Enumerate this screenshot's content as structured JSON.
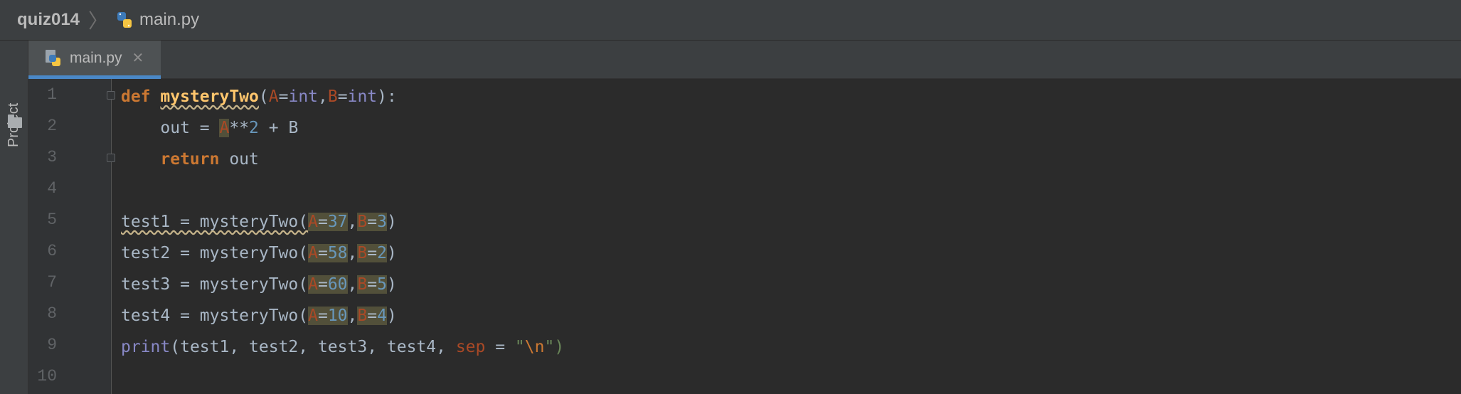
{
  "breadcrumb": {
    "project": "quiz014",
    "file": "main.py"
  },
  "toolstrip": {
    "project_label": "Project"
  },
  "tab": {
    "label": "main.py",
    "close": "✕"
  },
  "editor": {
    "line_numbers": [
      "1",
      "2",
      "3",
      "4",
      "5",
      "6",
      "7",
      "8",
      "9",
      "10"
    ],
    "lines": [
      [
        {
          "t": "def",
          "c": "kw"
        },
        {
          "t": " "
        },
        {
          "t": "mysteryTwo",
          "c": "fn bold wavy"
        },
        {
          "t": "("
        },
        {
          "t": "A",
          "c": "param"
        },
        {
          "t": "="
        },
        {
          "t": "int",
          "c": "builtin"
        },
        {
          "t": ","
        },
        {
          "t": "B",
          "c": "param"
        },
        {
          "t": "="
        },
        {
          "t": "int",
          "c": "builtin"
        },
        {
          "t": "):"
        }
      ],
      [
        {
          "t": "    out = "
        },
        {
          "t": "A",
          "c": "param hl"
        },
        {
          "t": "**"
        },
        {
          "t": "2",
          "c": "num"
        },
        {
          "t": " + B"
        }
      ],
      [
        {
          "t": "    "
        },
        {
          "t": "return",
          "c": "kw"
        },
        {
          "t": " out"
        }
      ],
      [
        {
          "t": ""
        }
      ],
      [
        {
          "t": "test1 = mysteryTwo(",
          "c": "wavy"
        },
        {
          "t": "A",
          "c": "param hl"
        },
        {
          "t": "=",
          "c": "hl"
        },
        {
          "t": "37",
          "c": "num hl"
        },
        {
          "t": ","
        },
        {
          "t": "B",
          "c": "param hl"
        },
        {
          "t": "=",
          "c": "hl"
        },
        {
          "t": "3",
          "c": "num hl"
        },
        {
          "t": ")"
        }
      ],
      [
        {
          "t": "test2 = mysteryTwo("
        },
        {
          "t": "A",
          "c": "param hl"
        },
        {
          "t": "=",
          "c": "hl"
        },
        {
          "t": "58",
          "c": "num hl"
        },
        {
          "t": ","
        },
        {
          "t": "B",
          "c": "param hl"
        },
        {
          "t": "=",
          "c": "hl"
        },
        {
          "t": "2",
          "c": "num hl"
        },
        {
          "t": ")"
        }
      ],
      [
        {
          "t": "test3 = mysteryTwo("
        },
        {
          "t": "A",
          "c": "param hl"
        },
        {
          "t": "=",
          "c": "hl"
        },
        {
          "t": "60",
          "c": "num hl"
        },
        {
          "t": ","
        },
        {
          "t": "B",
          "c": "param hl"
        },
        {
          "t": "=",
          "c": "hl"
        },
        {
          "t": "5",
          "c": "num hl"
        },
        {
          "t": ")"
        }
      ],
      [
        {
          "t": "test4 = mysteryTwo("
        },
        {
          "t": "A",
          "c": "param hl"
        },
        {
          "t": "=",
          "c": "hl"
        },
        {
          "t": "10",
          "c": "num hl"
        },
        {
          "t": ","
        },
        {
          "t": "B",
          "c": "param hl"
        },
        {
          "t": "=",
          "c": "hl"
        },
        {
          "t": "4",
          "c": "num hl"
        },
        {
          "t": ")"
        }
      ],
      [
        {
          "t": "print",
          "c": "builtin"
        },
        {
          "t": "(test1, test2, test3, test4, "
        },
        {
          "t": "sep",
          "c": "param"
        },
        {
          "t": " = "
        },
        {
          "t": "\"",
          "c": "str"
        },
        {
          "t": "\\n",
          "c": "esc"
        },
        {
          "t": "\")",
          "c": "str"
        }
      ],
      [
        {
          "t": ""
        }
      ]
    ]
  },
  "colors": {
    "background": "#2b2b2b",
    "gutter": "#313335",
    "tab_accent": "#4a88c7"
  }
}
